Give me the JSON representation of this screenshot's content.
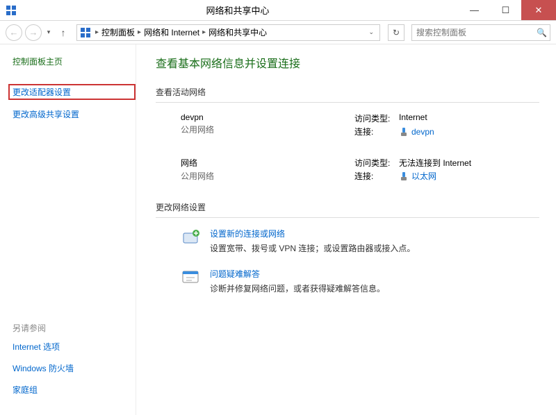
{
  "window": {
    "title": "网络和共享中心"
  },
  "breadcrumb": {
    "items": [
      "控制面板",
      "网络和 Internet",
      "网络和共享中心"
    ]
  },
  "search": {
    "placeholder": "搜索控制面板"
  },
  "sidebar": {
    "home": "控制面板主页",
    "adapter": "更改适配器设置",
    "advanced": "更改高级共享设置",
    "see_also_head": "另请参阅",
    "see_also": [
      "Internet 选项",
      "Windows 防火墙",
      "家庭组"
    ]
  },
  "content": {
    "title": "查看基本网络信息并设置连接",
    "active_head": "查看活动网络",
    "networks": [
      {
        "name": "devpn",
        "type": "公用网络",
        "access_label": "访问类型:",
        "access": "Internet",
        "conn_label": "连接:",
        "conn": "devpn"
      },
      {
        "name": "网络",
        "type": "公用网络",
        "access_label": "访问类型:",
        "access": "无法连接到 Internet",
        "conn_label": "连接:",
        "conn": "以太网"
      }
    ],
    "settings_head": "更改网络设置",
    "settings": [
      {
        "link": "设置新的连接或网络",
        "desc": "设置宽带、拨号或 VPN 连接；或设置路由器或接入点。"
      },
      {
        "link": "问题疑难解答",
        "desc": "诊断并修复网络问题，或者获得疑难解答信息。"
      }
    ]
  }
}
